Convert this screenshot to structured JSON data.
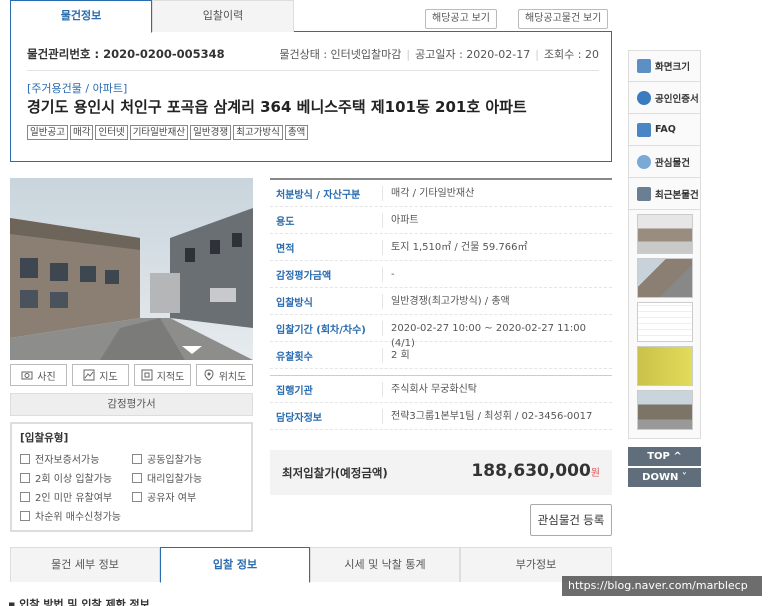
{
  "top_tabs": [
    "물건정보",
    "입찰이력"
  ],
  "notice_buttons": [
    "해당공고 보기",
    "해당공고물건 보기"
  ],
  "property": {
    "management_no": "물건관리번호 : 2020-0200-005348",
    "status": "물건상태 : 인터넷입찰마감",
    "notice_date": "공고일자 : 2020-02-17",
    "views": "조회수 : 20",
    "category": "[주거용건물 / 아파트]",
    "title": "경기도 용인시 처인구 포곡읍 삼계리 364 베니스주택 제101동 201호 아파트",
    "tags": [
      "일반공고",
      "매각",
      "인터넷",
      "기타일반재산",
      "일반경쟁",
      "최고가방식",
      "총액"
    ]
  },
  "photo_nav": [
    "사진",
    "지도",
    "지적도",
    "위치도"
  ],
  "appraisal_label": "감정평가서",
  "bid_type": {
    "title": "[입찰유형]",
    "options": [
      "전자보증서가능",
      "공동입찰가능",
      "2회 이상 입찰가능",
      "대리입찰가능",
      "2인 미만 유찰여부",
      "공유자 여부",
      "차순위 매수신청가능"
    ]
  },
  "details_a": [
    {
      "k": "처분방식 / 자산구분",
      "v": "매각 / 기타일반재산"
    },
    {
      "k": "용도",
      "v": "아파트"
    },
    {
      "k": "면적",
      "v": "토지 1,510㎡ / 건물 59.766㎡"
    },
    {
      "k": "감정평가금액",
      "v": "-"
    },
    {
      "k": "입찰방식",
      "v": "일반경쟁(최고가방식) / 총액"
    },
    {
      "k": "입찰기간 (회차/차수)",
      "v": "2020-02-27 10:00 ~ 2020-02-27 11:00 (4/1)"
    },
    {
      "k": "유찰횟수",
      "v": "2 회"
    }
  ],
  "details_b": [
    {
      "k": "집행기관",
      "v": "주식회사 무궁화신탁"
    },
    {
      "k": "담당자정보",
      "v": "전략3그룹1본부1팀 / 최성휘 / 02-3456-0017"
    }
  ],
  "min_price": {
    "label": "최저입찰가(예정금액)",
    "value": "188,630,000",
    "unit": "원"
  },
  "wish_button": "관심물건 등록",
  "bottom_tabs": [
    "물건 세부 정보",
    "입찰 정보",
    "시세 및 낙찰 통계",
    "부가정보"
  ],
  "section_head": "입찰 방법 및 입찰 제한 정보",
  "watermark": "https://blog.naver.com/marblecp",
  "quick_menu": [
    "화면크기",
    "공인인증서",
    "FAQ",
    "관심물건",
    "최근본물건"
  ],
  "topdown": [
    "TOP ^",
    "DOWN ˅"
  ],
  "colors": {
    "accent": "#2a6cb0",
    "price": "#333333"
  }
}
